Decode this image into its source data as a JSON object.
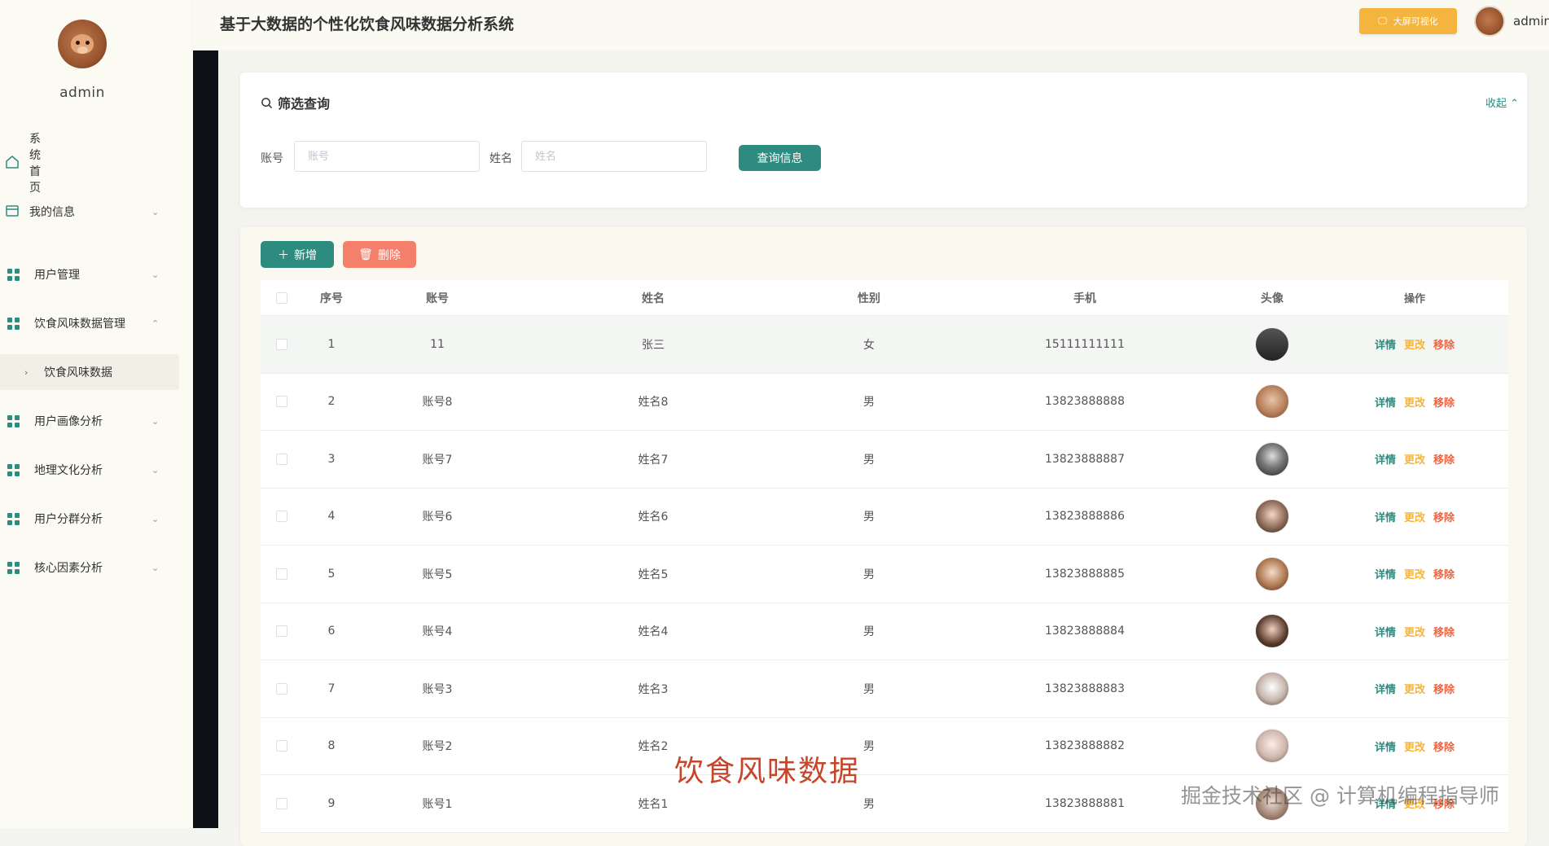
{
  "app": {
    "title": "基于大数据的个性化饮食风味数据分析系统",
    "big_screen_label": "大屏可视化",
    "username": "admin"
  },
  "sidebar": {
    "username": "admin",
    "items": [
      {
        "label": "系统首页",
        "icon": "home-icon",
        "has_chevron": false
      },
      {
        "label": "我的信息",
        "icon": "profile-icon",
        "has_chevron": true
      },
      {
        "label": "用户管理",
        "icon": "grid-icon",
        "has_chevron": true
      },
      {
        "label": "饮食风味数据管理",
        "icon": "grid-icon",
        "has_chevron": true,
        "expanded": true
      },
      {
        "label": "用户画像分析",
        "icon": "grid-icon",
        "has_chevron": true
      },
      {
        "label": "地理文化分析",
        "icon": "grid-icon",
        "has_chevron": true
      },
      {
        "label": "用户分群分析",
        "icon": "grid-icon",
        "has_chevron": true
      },
      {
        "label": "核心因素分析",
        "icon": "grid-icon",
        "has_chevron": true
      }
    ],
    "active_subitem": "饮食风味数据"
  },
  "filter": {
    "title": "筛选查询",
    "collapse_label": "收起",
    "account_label": "账号",
    "account_placeholder": "账号",
    "name_label": "姓名",
    "name_placeholder": "姓名",
    "query_button": "查询信息"
  },
  "toolbar": {
    "add_label": "新增",
    "delete_label": "删除"
  },
  "table": {
    "columns": [
      "序号",
      "账号",
      "姓名",
      "性别",
      "手机",
      "头像",
      "操作"
    ],
    "actions": {
      "detail": "详情",
      "edit": "更改",
      "remove": "移除"
    },
    "rows": [
      {
        "no": "1",
        "account": "11",
        "name": "张三",
        "sex": "女",
        "phone": "15111111111"
      },
      {
        "no": "2",
        "account": "账号8",
        "name": "姓名8",
        "sex": "男",
        "phone": "13823888888"
      },
      {
        "no": "3",
        "account": "账号7",
        "name": "姓名7",
        "sex": "男",
        "phone": "13823888887"
      },
      {
        "no": "4",
        "account": "账号6",
        "name": "姓名6",
        "sex": "男",
        "phone": "13823888886"
      },
      {
        "no": "5",
        "account": "账号5",
        "name": "姓名5",
        "sex": "男",
        "phone": "13823888885"
      },
      {
        "no": "6",
        "account": "账号4",
        "name": "姓名4",
        "sex": "男",
        "phone": "13823888884"
      },
      {
        "no": "7",
        "account": "账号3",
        "name": "姓名3",
        "sex": "男",
        "phone": "13823888883"
      },
      {
        "no": "8",
        "account": "账号2",
        "name": "姓名2",
        "sex": "男",
        "phone": "13823888882"
      },
      {
        "no": "9",
        "account": "账号1",
        "name": "姓名1",
        "sex": "男",
        "phone": "13823888881"
      }
    ]
  },
  "overlay": {
    "caption": "饮食风味数据",
    "watermark": "掘金技术社区 @ 计算机编程指导师"
  },
  "colors": {
    "accent": "#2e8b80",
    "warning": "#f5b43d",
    "danger": "#f47f6b",
    "remove_text": "#f0643f"
  }
}
